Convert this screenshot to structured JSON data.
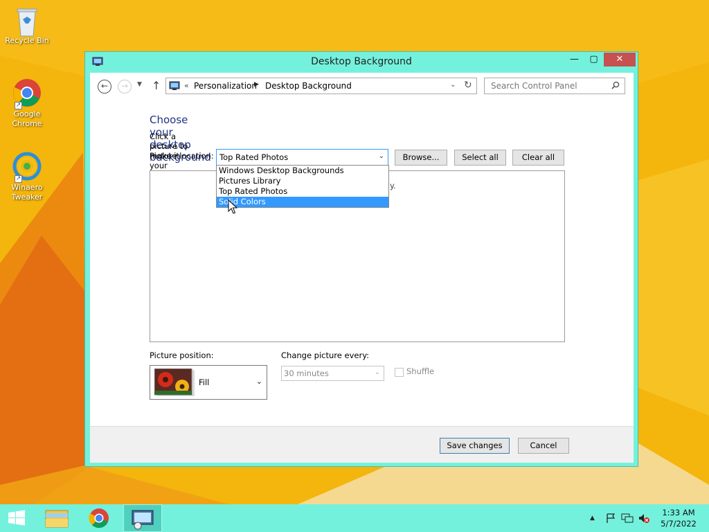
{
  "desktop": {
    "icons": [
      {
        "label": "Recycle Bin",
        "icon": "recycle-bin-icon"
      },
      {
        "label": "Google Chrome",
        "icon": "chrome-icon"
      },
      {
        "label": "Winaero Tweaker",
        "icon": "winaero-tweaker-icon"
      }
    ]
  },
  "window": {
    "title": "Desktop Background",
    "controls": {
      "minimize": "minimize-icon",
      "maximize": "maximize-icon",
      "close": "close-icon"
    }
  },
  "address_bar": {
    "overflow": "«",
    "breadcrumbs": [
      "Personalization",
      "Desktop Background"
    ],
    "search_placeholder": "Search Control Panel"
  },
  "content": {
    "heading": "Choose your desktop background",
    "intro": "Click a picture to make it your desktop background, or select more than one picture to create a slide show.",
    "location_label": "Picture location:",
    "location_value": "Top Rated Photos",
    "location_options": [
      "Windows Desktop Backgrounds",
      "Pictures Library",
      "Top Rated Photos",
      "Solid Colors"
    ],
    "highlighted_option": "Solid Colors",
    "hint_fragment": "y.",
    "buttons": {
      "browse": "Browse...",
      "select_all": "Select all",
      "clear_all": "Clear all"
    },
    "position_label": "Picture position:",
    "position_value": "Fill",
    "change_label": "Change picture every:",
    "change_value": "30 minutes",
    "shuffle_label": "Shuffle",
    "shuffle_checked": false
  },
  "footer": {
    "save": "Save changes",
    "cancel": "Cancel"
  },
  "taskbar": {
    "items": [
      "start-icon",
      "file-explorer-icon",
      "chrome-icon",
      "control-panel-icon"
    ],
    "tray": [
      "show-hidden-icons-arrow",
      "action-center-flag-icon",
      "network-icon",
      "volume-muted-icon"
    ],
    "time": "1:33 AM",
    "date": "5/7/2022"
  },
  "colors": {
    "window_frame": "#74f1dc",
    "heading": "#1e3287",
    "selection": "#3399ff",
    "close": "#c75050"
  }
}
